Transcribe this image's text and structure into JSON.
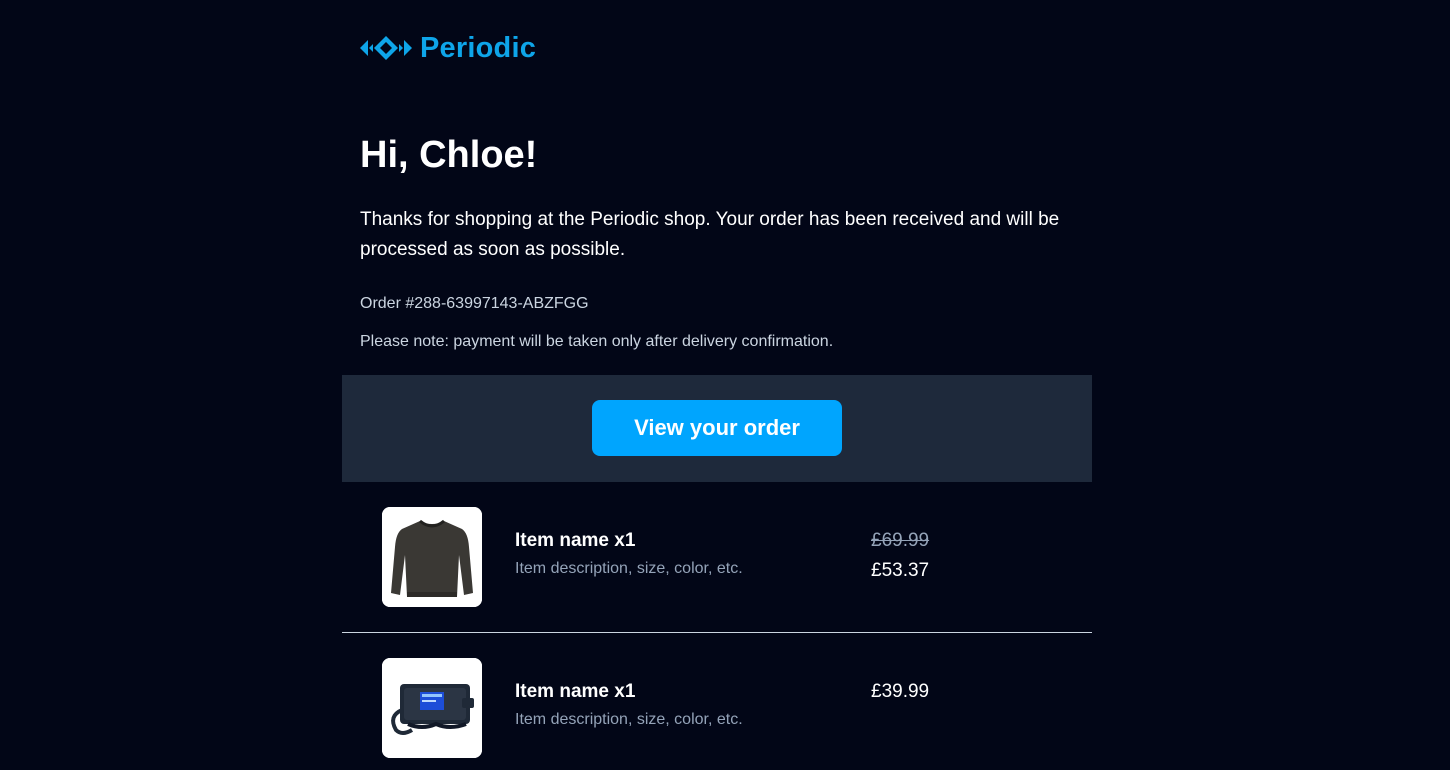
{
  "brand": {
    "name": "Periodic",
    "logo_icon": "periodic-diamonds-logo",
    "color": "#0ea5e9"
  },
  "greeting": "Hi, Chloe!",
  "intro": "Thanks for shopping at the Periodic shop. Your order has been received and will be processed as soon as possible.",
  "order_number": "Order #288-63997143-ABZFGG",
  "note": "Please note: payment will be taken only after delivery confirmation.",
  "cta": {
    "label": "View your order",
    "color": "#00a5fe"
  },
  "items": [
    {
      "image_icon": "sweater-image",
      "name": "Item name x1",
      "description": "Item description, size, color, etc.",
      "original_price": "£69.99",
      "price": "£53.37"
    },
    {
      "image_icon": "messenger-bag-image",
      "name": "Item name x1",
      "description": "Item description, size, color, etc.",
      "price": "£39.99"
    }
  ],
  "colors": {
    "background": "#020617",
    "band": "#1e293b",
    "muted_text": "#94a3b8"
  }
}
